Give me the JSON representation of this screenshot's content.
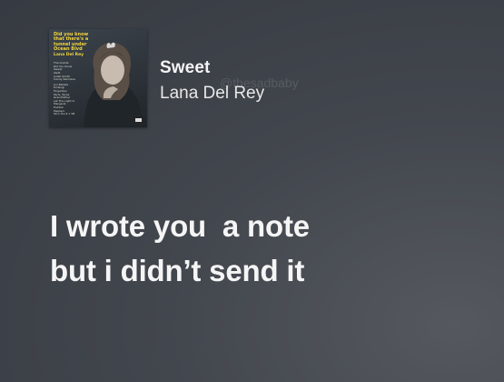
{
  "track": {
    "title": "Sweet",
    "artist": "Lana Del Rey"
  },
  "cover_art": {
    "title": "Did you know\nthat there's a\ntunnel under\nOcean Blvd",
    "artist": "Lana Del Rey",
    "tracklist": [
      "The Grants",
      "Did You Know",
      "Sweet",
      "A&W",
      "Judah Smith",
      "Candy Necklace",
      "Jon Batiste",
      "Kintsugi",
      "Fingertips",
      "Paris, Texas",
      "Grandfather",
      "Let The Light In",
      "Margaret",
      "Fishtail",
      "Peppers",
      "Taco Truck x VB"
    ],
    "title_color": "#f2d43d"
  },
  "watermark": "@thesadbaby",
  "lyrics": {
    "line1": "I wrote you  a note",
    "line2": "but i didn’t send it"
  },
  "colors": {
    "background": "#3f4349",
    "text": "#f5f5f5"
  }
}
